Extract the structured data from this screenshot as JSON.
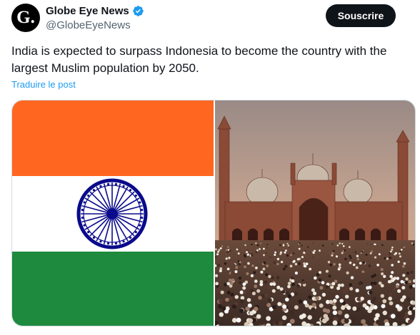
{
  "tweet": {
    "avatar_letter": "G.",
    "display_name": "Globe Eye News",
    "handle": "@GlobeEyeNews",
    "follow_label": "Souscrire",
    "text": "India is expected to surpass Indonesia to become the country with the largest Muslim population by 2050.",
    "translate_label": "Traduire le post",
    "icons": {
      "verified": "verified-badge-icon"
    }
  },
  "colors": {
    "saffron": "#ff6720",
    "white": "#ffffff",
    "green": "#1e8a3d",
    "chakra": "#0a0a8c",
    "verified": "#1d9bf0"
  }
}
